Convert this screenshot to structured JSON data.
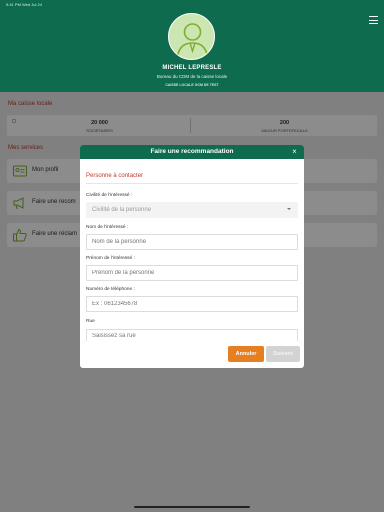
{
  "status_bar": {
    "left": "9:41 PM  Wed Jul 24",
    "right": ""
  },
  "header": {
    "user_name": "MICHEL LEPRESLE",
    "user_role": "Bureau du CDM de la caisse locale",
    "caisse": "CAISSE LOCALE GCM DE TEST"
  },
  "caisse_section": {
    "title": "Ma caisse locale"
  },
  "stats": [
    {
      "value": "20 000",
      "label": "SOCIÉTAIRES"
    },
    {
      "value": "200",
      "label": "VALEUR PORTEFEUILLE"
    }
  ],
  "services_section": {
    "title": "Mes services"
  },
  "services": [
    {
      "label": "Mon profil",
      "icon": "profile-card-icon"
    },
    {
      "label": "Faire une recom",
      "icon": "megaphone-icon"
    },
    {
      "label": "Faire une réclam",
      "icon": "thumbs-up-icon"
    }
  ],
  "modal": {
    "title": "Faire une recommandation",
    "close": "×",
    "section_heading": "Personne à contacter",
    "fields": {
      "civilite": {
        "label": "Civilité de l'intéressé :",
        "value": "",
        "placeholder": "Civilité de la personne"
      },
      "nom": {
        "label": "Nom de l'intéressé :",
        "placeholder": "Nom de la personne"
      },
      "prenom": {
        "label": "Prénom de l'intéressé :",
        "placeholder": "Prénom de la personne"
      },
      "telephone": {
        "label": "Numéro de téléphone :",
        "placeholder": "Ex : 0612345678"
      },
      "rue": {
        "label": "Rue",
        "placeholder": "Saisissez sa rue"
      }
    },
    "buttons": {
      "cancel": "Annuler",
      "next": "Suivant"
    }
  },
  "colors": {
    "brand_green": "#0e6b4d",
    "accent_red": "#c0392b",
    "cancel_orange": "#e67e22",
    "disabled_gray": "#d3d3d3",
    "icon_green": "#7fae2f"
  }
}
